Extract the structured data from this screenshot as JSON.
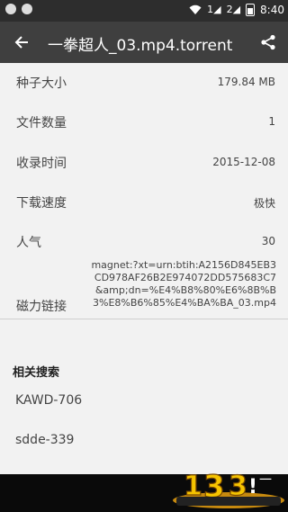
{
  "status_bar": {
    "sim1": "1",
    "sim2": "2",
    "time": "8:40"
  },
  "app_bar": {
    "title": "一拳超人_03.mp4.torrent",
    "back_icon": "arrow-back-icon",
    "share_icon": "share-icon"
  },
  "info": {
    "seed_size_label": "种子大小",
    "seed_size_value": "179.84 MB",
    "file_count_label": "文件数量",
    "file_count_value": "1",
    "recorded_label": "收录时间",
    "recorded_value": "2015-12-08",
    "speed_label": "下载速度",
    "speed_value": "极快",
    "popularity_label": "人气",
    "popularity_value": "30",
    "magnet_label": "磁力链接",
    "magnet_value": "magnet:?xt=urn:btih:A2156D845EB3CD978AF26B2E974072DD575683C7&amp;dn=%E4%B8%80%E6%8B%B3%E8%B6%85%E4%BA%BA_03.mp4"
  },
  "related": {
    "header": "相关搜索",
    "items": [
      "KAWD-706",
      "sdde-339"
    ]
  },
  "colors": {
    "app_bar": "#3f3f3f",
    "status_bar": "#2d2d2d",
    "background": "#f2f2f2"
  }
}
